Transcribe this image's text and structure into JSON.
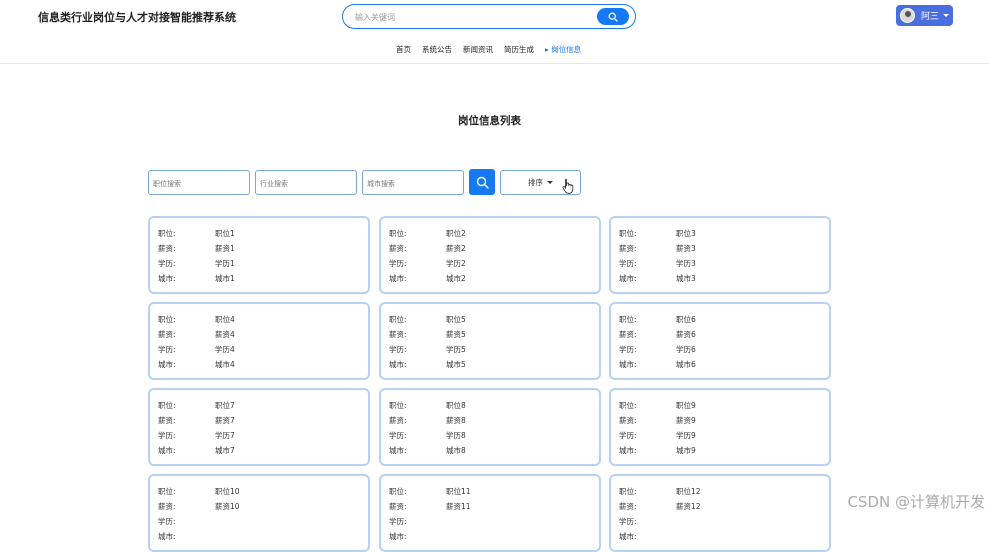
{
  "header": {
    "site_title": "信息类行业岗位与人才对接智能推荐系统",
    "search_placeholder": "输入关键词",
    "user_name": "阿三"
  },
  "nav": {
    "items": [
      {
        "label": "首页",
        "active": false
      },
      {
        "label": "系统公告",
        "active": false
      },
      {
        "label": "新闻资讯",
        "active": false
      },
      {
        "label": "简历生成",
        "active": false
      },
      {
        "label": "岗位信息",
        "active": true
      }
    ],
    "active_marker": "▸"
  },
  "main": {
    "title": "岗位信息列表",
    "filters": {
      "job_placeholder": "职位搜索",
      "industry_placeholder": "行业搜索",
      "city_placeholder": "城市搜索",
      "sort_label": "排序"
    },
    "field_labels": {
      "job": "职位:",
      "salary": "薪资:",
      "education": "学历:",
      "city": "城市:"
    },
    "cards": [
      {
        "job": "职位1",
        "salary": "薪资1",
        "education": "学历1",
        "city": "城市1"
      },
      {
        "job": "职位2",
        "salary": "薪资2",
        "education": "学历2",
        "city": "城市2"
      },
      {
        "job": "职位3",
        "salary": "薪资3",
        "education": "学历3",
        "city": "城市3"
      },
      {
        "job": "职位4",
        "salary": "薪资4",
        "education": "学历4",
        "city": "城市4"
      },
      {
        "job": "职位5",
        "salary": "薪资5",
        "education": "学历5",
        "city": "城市5"
      },
      {
        "job": "职位6",
        "salary": "薪资6",
        "education": "学历6",
        "city": "城市6"
      },
      {
        "job": "职位7",
        "salary": "薪资7",
        "education": "学历7",
        "city": "城市7"
      },
      {
        "job": "职位8",
        "salary": "薪资8",
        "education": "学历8",
        "city": "城市8"
      },
      {
        "job": "职位9",
        "salary": "薪资9",
        "education": "学历9",
        "city": "城市9"
      },
      {
        "job": "职位10",
        "salary": "薪资10",
        "education": "",
        "city": ""
      },
      {
        "job": "职位11",
        "salary": "薪资11",
        "education": "",
        "city": ""
      },
      {
        "job": "职位12",
        "salary": "薪资12",
        "education": "",
        "city": ""
      }
    ]
  },
  "watermark": "CSDN @计算机开发",
  "colors": {
    "accent": "#1479f2",
    "user_button": "#4a6ee0",
    "card_border": "#b6d2f2"
  },
  "icons": {
    "search": "magnifier-icon",
    "caret": "caret-down-icon",
    "pointer": "hand-cursor-icon"
  }
}
